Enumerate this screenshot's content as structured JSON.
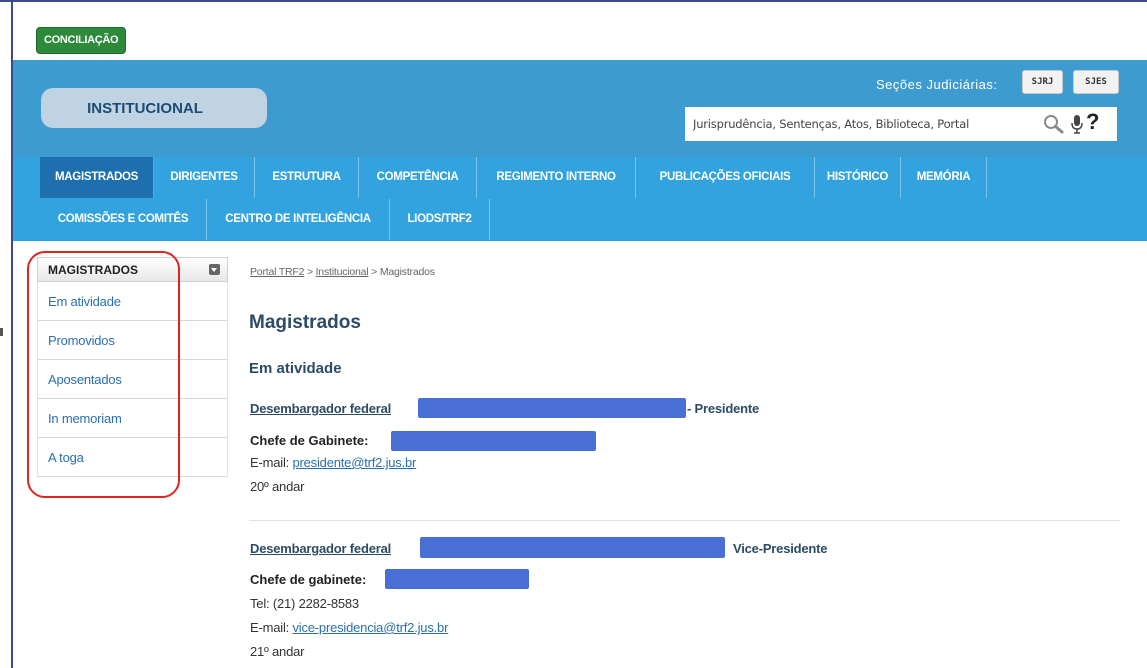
{
  "conciliacao_label": "CONCILIAÇÃO",
  "header": {
    "institucional_label": "INSTITUCIONAL",
    "secoes_label": "Seções Judiciárias:",
    "secoes_buttons": [
      "SJRJ",
      "SJES"
    ],
    "search_placeholder": "Jurisprudência, Sentenças, Atos, Biblioteca, Portal",
    "search_icons": [
      "search-icon",
      "microphone-icon",
      "help-icon"
    ],
    "help_glyph": "?"
  },
  "nav": {
    "row1": [
      "MAGISTRADOS",
      "DIRIGENTES",
      "ESTRUTURA",
      "COMPETÊNCIA",
      "REGIMENTO INTERNO",
      "PUBLICAÇÕES OFICIAIS",
      "HISTÓRICO",
      "MEMÓRIA"
    ],
    "row2": [
      "COMISSÕES E COMITÊS",
      "CENTRO DE INTELIGÊNCIA",
      "LIODS/TRF2"
    ],
    "active": "MAGISTRADOS"
  },
  "sidebar": {
    "title": "MAGISTRADOS",
    "items": [
      "Em atividade",
      "Promovidos",
      "Aposentados",
      "In memoriam",
      "A toga"
    ]
  },
  "breadcrumb": {
    "links": [
      "Portal TRF2",
      "Institucional"
    ],
    "separator": ">",
    "current": "Magistrados"
  },
  "main": {
    "title": "Magistrados",
    "subtitle": "Em atividade",
    "entries": [
      {
        "title_prefix": "Desembargador federal",
        "title_suffix": "- Presidente",
        "chefe_label": "Chefe de Gabinete:",
        "email_label": "E-mail:",
        "email": "presidente@trf2.jus.br",
        "andar": "20º andar"
      },
      {
        "title_prefix": "Desembargador federal",
        "title_suffix": "Vice-Presidente",
        "chefe_label": "Chefe de gabinete:",
        "tel": "Tel: (21) 2282-8583",
        "email_label": "E-mail:",
        "email": "vice-presidencia@trf2.jus.br",
        "andar": "21º andar"
      }
    ]
  },
  "colors": {
    "header_bg": "#3d9bd0",
    "nav_bg": "#33a3df",
    "nav_active": "#1e6fae",
    "conciliacao_green": "#2d8a3a",
    "highlight_red": "#e0241f",
    "redaction_blue": "#4a6fd4"
  }
}
